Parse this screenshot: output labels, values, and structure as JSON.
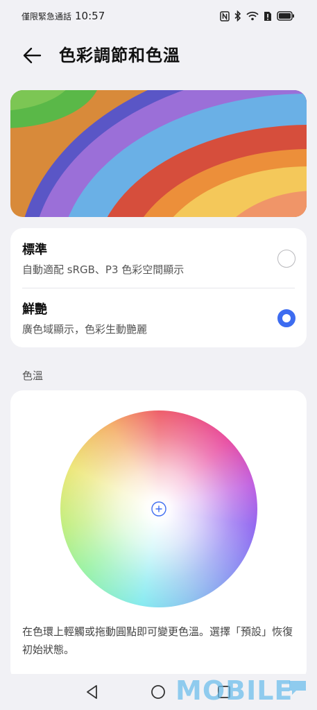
{
  "status_bar": {
    "carrier": "僅限緊急通話",
    "time": "10:57",
    "icons": [
      "nfc-icon",
      "bluetooth-icon",
      "wifi-icon",
      "sim-alert-icon",
      "battery-icon"
    ]
  },
  "header": {
    "title": "色彩調節和色溫",
    "back_icon": "arrow-left-icon"
  },
  "options": [
    {
      "title": "標準",
      "desc": "自動適配 sRGB、P3 色彩空間顯示",
      "selected": false
    },
    {
      "title": "鮮艷",
      "desc": "廣色域顯示，色彩生動艷麗",
      "selected": true
    }
  ],
  "temperature": {
    "section_label": "色溫",
    "hint": "在色環上輕觸或拖動圓點即可變更色溫。選擇「預設」恢復初始狀態。"
  },
  "nav": {
    "buttons": [
      "back-triangle-icon",
      "home-circle-icon",
      "recents-square-icon"
    ]
  },
  "watermark": "MOBILE",
  "colors": {
    "accent": "#3d6cf0",
    "background": "#f1f1f5",
    "card": "#ffffff"
  }
}
